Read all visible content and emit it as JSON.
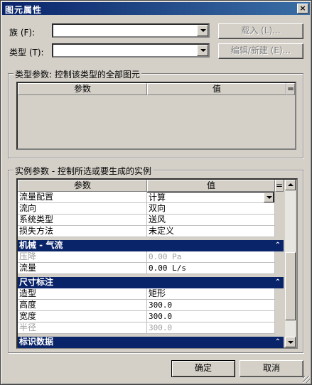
{
  "window": {
    "title": "图元属性",
    "close_glyph": "×"
  },
  "header": {
    "family_label": "族 (F):",
    "family_value": "",
    "load_button": "载入 (L)...",
    "type_label": "类型 (T):",
    "type_value": "",
    "edit_type_button": "编辑/新建 (E)..."
  },
  "type_params": {
    "group_title": "类型参数: 控制该类型的全部图元",
    "col_param": "参数",
    "col_value": "值",
    "col_sort": "="
  },
  "instance_params": {
    "group_title": "实例参数 - 控制所选或要生成的实例",
    "col_param": "参数",
    "col_value": "值",
    "col_sort": "=",
    "rows": [
      {
        "param": "流量配置",
        "value": "计算"
      },
      {
        "param": "流向",
        "value": "双向"
      },
      {
        "param": "系统类型",
        "value": "送风"
      },
      {
        "param": "损失方法",
        "value": "未定义"
      }
    ],
    "section_mech": "机械 - 气流",
    "mech_rows": [
      {
        "param": "压降",
        "value": "0.00 Pa"
      },
      {
        "param": "流量",
        "value": "0.00 L/s"
      }
    ],
    "section_dim": "尺寸标注",
    "dim_rows": [
      {
        "param": "造型",
        "value": "矩形"
      },
      {
        "param": "高度",
        "value": "300.0"
      },
      {
        "param": "宽度",
        "value": "300.0"
      },
      {
        "param": "半径",
        "value": "300.0"
      }
    ],
    "section_id": "标识数据",
    "collapse_glyph": "⌃"
  },
  "footer": {
    "ok_button": "确定",
    "cancel_button": "取消"
  },
  "colors": {
    "section_bg": "#0a246a",
    "dialog_bg": "#d4d0c8"
  }
}
